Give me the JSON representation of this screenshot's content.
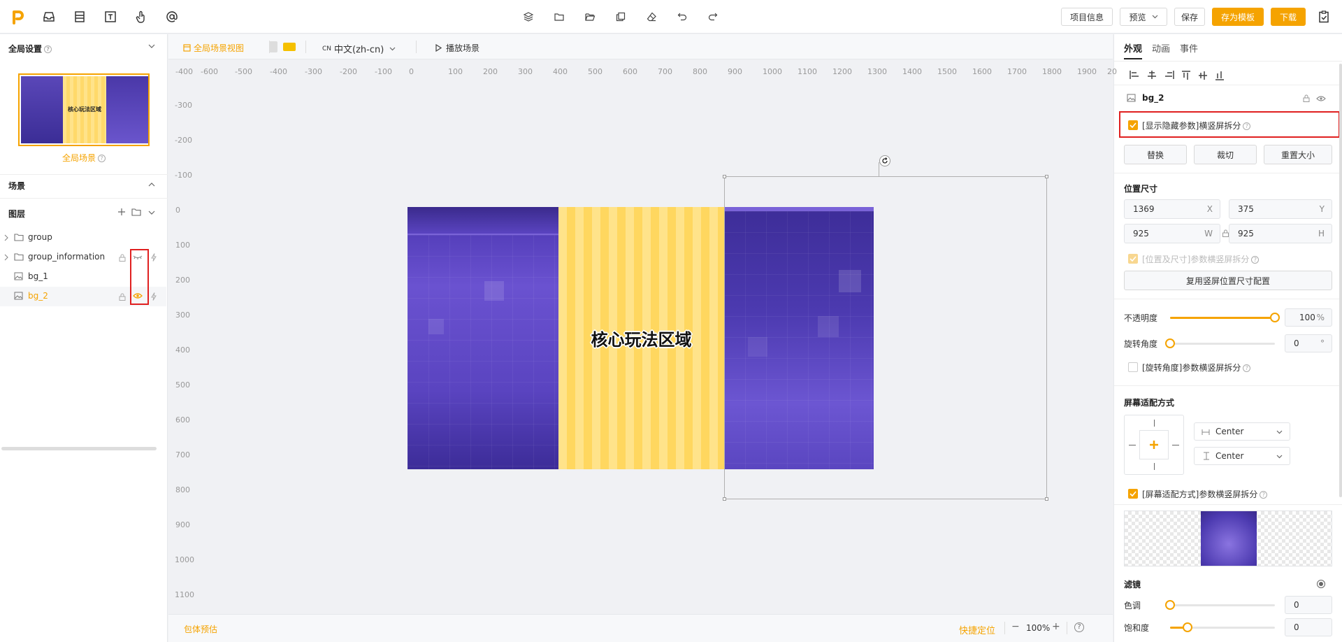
{
  "topbar": {
    "buttons": {
      "project_info": "项目信息",
      "preview": "预览",
      "save": "保存",
      "save_template": "存为模板",
      "download": "下载"
    }
  },
  "left": {
    "global_settings": "全局设置",
    "global_scene": "全局场景",
    "scene": "场景",
    "layers_title": "图层",
    "layers": [
      {
        "name": "group",
        "type": "folder"
      },
      {
        "name": "group_information",
        "type": "folder"
      },
      {
        "name": "bg_1",
        "type": "image"
      },
      {
        "name": "bg_2",
        "type": "image"
      }
    ]
  },
  "canvas": {
    "toolbar": {
      "global_view": "全局场景视图",
      "lang_prefix": "CN",
      "language": "中文(zh-cn)",
      "play": "播放场景"
    },
    "ruler_h": [
      "-400",
      "-600",
      "-500",
      "-400",
      "-300",
      "-200",
      "-100",
      "0",
      "100",
      "200",
      "300",
      "400",
      "500",
      "600",
      "700",
      "800",
      "900",
      "1000",
      "1100",
      "1200",
      "1300",
      "1400",
      "1500",
      "1600",
      "1700",
      "1800",
      "1900",
      "20"
    ],
    "ruler_v": [
      "-300",
      "-200",
      "-100",
      "0",
      "100",
      "200",
      "300",
      "400",
      "500",
      "600",
      "700",
      "800",
      "900",
      "1000",
      "1100"
    ],
    "core_text": "核心玩法区域",
    "thumb_text": "核心玩法区域",
    "bottom": {
      "estimate": "包体预估",
      "quick_locate": "快捷定位",
      "zoom": "100%"
    }
  },
  "right": {
    "tabs": [
      "外观",
      "动画",
      "事件"
    ],
    "layer_name": "bg_2",
    "show_hidden": "[显示隐藏参数]横竖屏拆分",
    "btn_replace": "替换",
    "btn_crop": "裁切",
    "btn_reset": "重置大小",
    "pos_size_title": "位置尺寸",
    "x": "1369",
    "x_label": "X",
    "y": "375",
    "y_label": "Y",
    "w": "925",
    "w_label": "W",
    "h": "925",
    "h_label": "H",
    "pos_split": "[位置及尺寸]参数横竖屏拆分",
    "reuse_btn": "复用竖屏位置尺寸配置",
    "opacity_label": "不透明度",
    "opacity_value": "100",
    "opacity_unit": "%",
    "opacity_fraction": 1.0,
    "rotation_label": "旋转角度",
    "rotation_value": "0",
    "rotation_unit": "°",
    "rotation_split": "[旋转角度]参数横竖屏拆分",
    "fit_title": "屏幕适配方式",
    "fit_h": "Center",
    "fit_v": "Center",
    "fit_split": "[屏幕适配方式]参数横竖屏拆分",
    "filter_title": "滤镜",
    "hue_label": "色调",
    "hue_value": "0",
    "sat_label": "饱和度",
    "sat_value": "0"
  },
  "colors": {
    "accent": "#f5a300",
    "highlight_red": "#e02020",
    "purple_dark": "#3a2a8c",
    "purple_light": "#7a63d8",
    "stripe_yellow": "#ffe38a"
  }
}
